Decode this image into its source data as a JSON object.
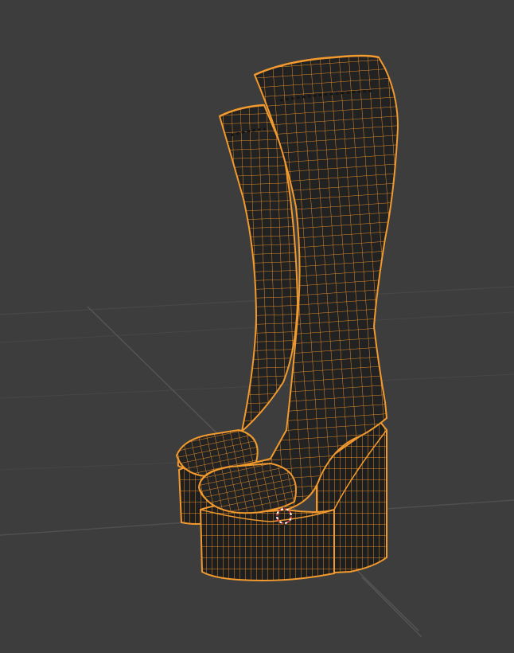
{
  "viewport": {
    "background_color": "#3d3d3d",
    "grid_color": "#4a4a4a",
    "axis_line_color": "#555555"
  },
  "scene": {
    "objects": [
      {
        "name": "boot-left-wireframe",
        "selected": true
      },
      {
        "name": "boot-right-wireframe",
        "selected": true
      }
    ],
    "mesh_fill_color": "#222222",
    "wire_color": "#e08a2a",
    "outline_color": "#f29a2e",
    "cursor_colors": [
      "#e23a3a",
      "#ffffff"
    ],
    "cursor_icon": "3d-cursor-icon"
  }
}
